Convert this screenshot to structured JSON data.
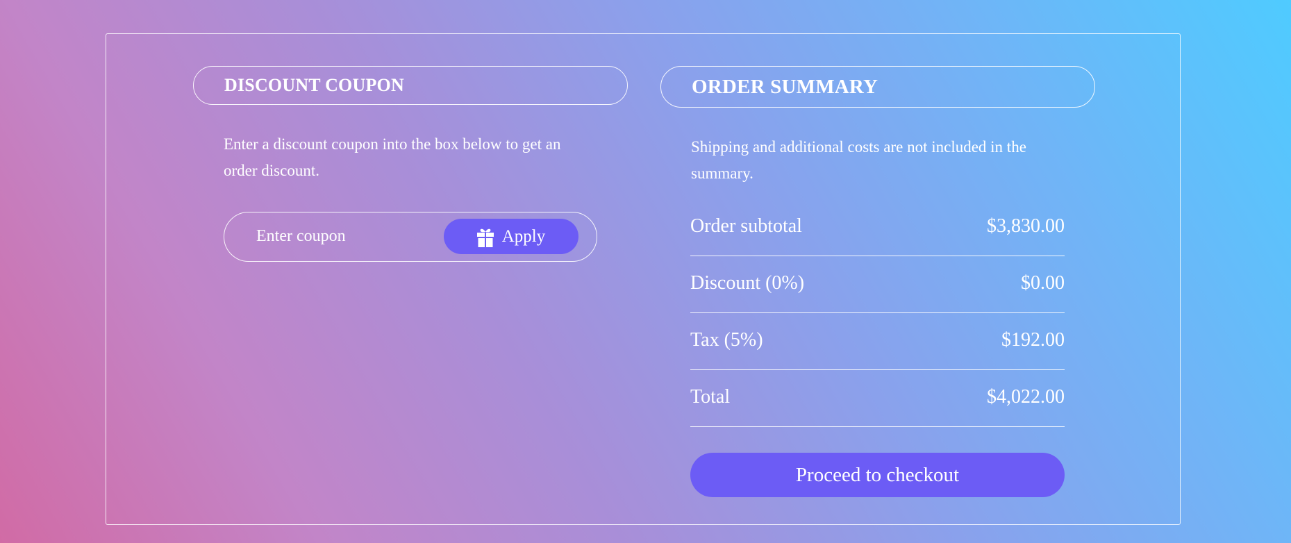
{
  "coupon": {
    "title": "DISCOUNT COUPON",
    "description": "Enter a discount coupon into the box below to get an order discount.",
    "input_placeholder": "Enter coupon",
    "input_value": "",
    "apply_label": "Apply",
    "apply_icon": "gift-icon"
  },
  "summary": {
    "title": "ORDER SUMMARY",
    "description": "Shipping and additional costs are not included in the summary.",
    "rows": [
      {
        "label": "Order subtotal",
        "value": "$3,830.00"
      },
      {
        "label": "Discount (0%)",
        "value": "$0.00"
      },
      {
        "label": "Tax (5%)",
        "value": "$192.00"
      },
      {
        "label": "Total",
        "value": "$4,022.00"
      }
    ],
    "checkout_label": "Proceed to checkout"
  },
  "colors": {
    "accent": "#6c5cf5",
    "text": "#ffffff",
    "gradient_start": "#d16ba5",
    "gradient_end": "#4fcbff"
  }
}
